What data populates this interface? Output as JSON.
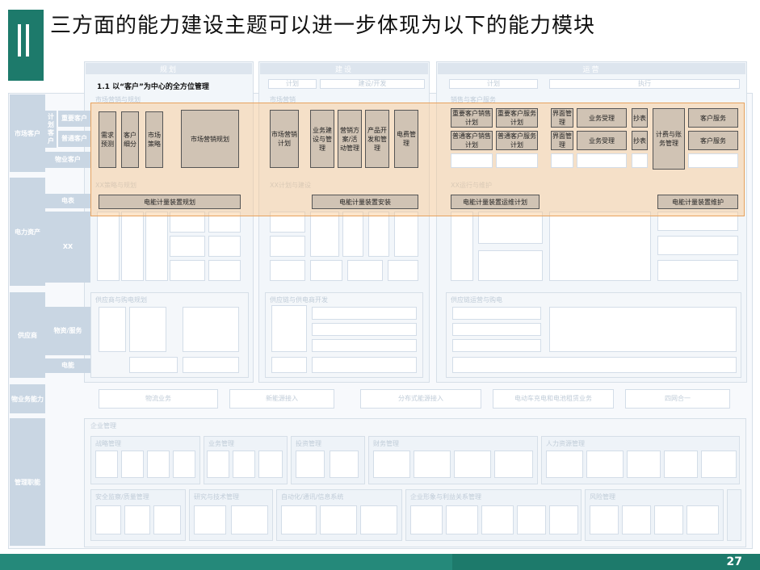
{
  "title": "三方面的能力建设主题可以进一步体现为以下的能力模块",
  "section_marker": "Ⅱ",
  "page_number": "27",
  "highlight_label": "1.1 以“客户”为中心的全方位管理",
  "columns": [
    "规划",
    "建设",
    "运营"
  ],
  "column_sub": [
    "计划",
    "建设/开发",
    "计划",
    "执行"
  ],
  "side_labels": [
    "市场客户",
    "电力资产",
    "供应商",
    "物业务能力",
    "管理职能"
  ],
  "sub_labels": {
    "market": [
      "计划客户",
      "重要客户",
      "普通客户",
      "物业客户"
    ],
    "asset": [
      "电表",
      "XX"
    ],
    "supplier": [
      "物资/服务",
      "电能"
    ]
  },
  "highlight_boxes": {
    "plan": [
      "需求预测",
      "客户细分",
      "市场策略",
      "市场营销规划"
    ],
    "build": [
      "市场营销计划",
      "业务建设与管理",
      "营销方案/活动管理",
      "产品开发和管理",
      "电费管理"
    ],
    "ops_left": [
      "重要客户销售计划",
      "重要客户服务计划",
      "普通客户销售计划",
      "普通客户服务计划"
    ],
    "ops_mid": [
      "界面管理",
      "业务受理",
      "界面管理",
      "业务受理"
    ],
    "ops_small": [
      "抄表",
      "抄表"
    ],
    "ops_billing": "计费与账务管理",
    "ops_service": [
      "客户服务",
      "客户服务"
    ],
    "meter_row": [
      "电能计量装置规划",
      "电能计量装置安装",
      "电能计量装置运维计划",
      "电能计量装置维护"
    ]
  },
  "ghost_texts": {
    "plan_header": "市场营销与规划",
    "build_header": "市场营销",
    "ops_header": "销售与客户服务",
    "xx_plan": "XX策略与规划",
    "xx_build": "XX计划与建设",
    "xx_ops": "XX运行与维护",
    "supplier_plan": "供应商与购电规划",
    "supplier_build": "供应链与供电商开发",
    "supplier_ops": "供应链运营与购电",
    "general_mgmt": "企业管理",
    "strategy": "战略管理",
    "business": "业务管理",
    "invest": "投资管理",
    "finance": "财务管理",
    "hr": "人力资源管理",
    "safety": "安全监察/质量管理",
    "research": "研究与技术管理",
    "it": "自动化/通讯/信息系统",
    "brand": "企业形象与利益关系管理",
    "risk": "风险管理",
    "logistics": [
      "物流业务",
      "新能源接入",
      "分布式能源接入",
      "电动车充电和电池租赁业务",
      "四网合一"
    ]
  }
}
